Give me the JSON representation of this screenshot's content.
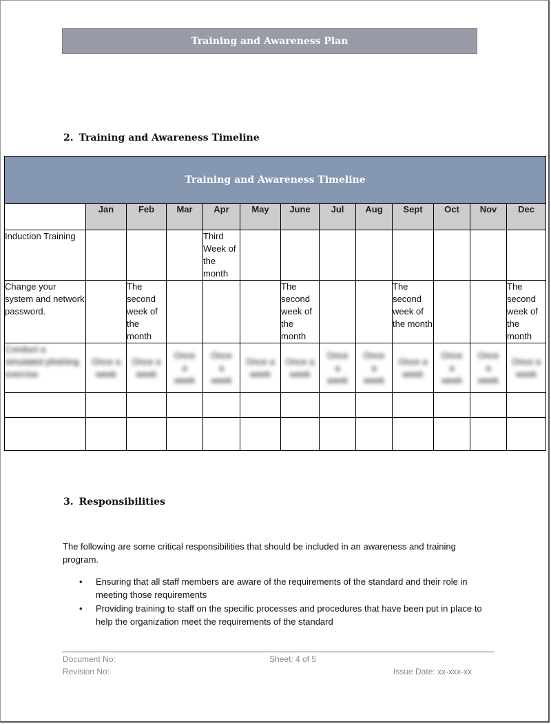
{
  "header": {
    "title": "Training and Awareness Plan"
  },
  "section2": {
    "number": "2.",
    "heading": "Training and Awareness Timeline",
    "table": {
      "banner": "Training and Awareness Timeline",
      "months": [
        "Jan",
        "Feb",
        "Mar",
        "Apr",
        "May",
        "June",
        "Jul",
        "Aug",
        "Sept",
        "Oct",
        "Nov",
        "Dec"
      ],
      "rows": [
        {
          "label": "Induction Training",
          "cells": [
            "",
            "",
            "",
            "Third Week of the month",
            "",
            "",
            "",
            "",
            "",
            "",
            "",
            ""
          ]
        },
        {
          "label": "Change your system and network password.",
          "cells": [
            "",
            "The second week of the month",
            "",
            "",
            "",
            "The second week of the month",
            "",
            "",
            "The second week of the month",
            "",
            "",
            "The second week of the month"
          ]
        },
        {
          "label": "Conduct a simulated phishing exercise",
          "blurred": true,
          "cells": [
            "Once a week",
            "Once a week",
            "Once a week",
            "Once a week",
            "Once a week",
            "Once a week",
            "Once a week",
            "Once a week",
            "Once a week",
            "Once a week",
            "Once a week",
            "Once a week"
          ]
        },
        {
          "label": "",
          "cells": [
            "",
            "",
            "",
            "",
            "",
            "",
            "",
            "",
            "",
            "",
            "",
            ""
          ]
        },
        {
          "label": "",
          "cells": [
            "",
            "",
            "",
            "",
            "",
            "",
            "",
            "",
            "",
            "",
            "",
            ""
          ]
        }
      ]
    }
  },
  "section3": {
    "number": "3.",
    "heading": "Responsibilities",
    "intro": "The following are some critical responsibilities that should be included in an awareness and training program.",
    "bullets": [
      "Ensuring that all staff members are aware of the requirements of the standard and their role in meeting those requirements",
      "Providing training to staff on the specific processes and procedures that have been put in place to help the organization meet the requirements of the standard"
    ]
  },
  "footer": {
    "document_no": "Document No:",
    "revision_no": "Revision No:",
    "sheet": "Sheet: 4 of 5",
    "issue_date": "Issue Date: xx-xxx-xx"
  }
}
